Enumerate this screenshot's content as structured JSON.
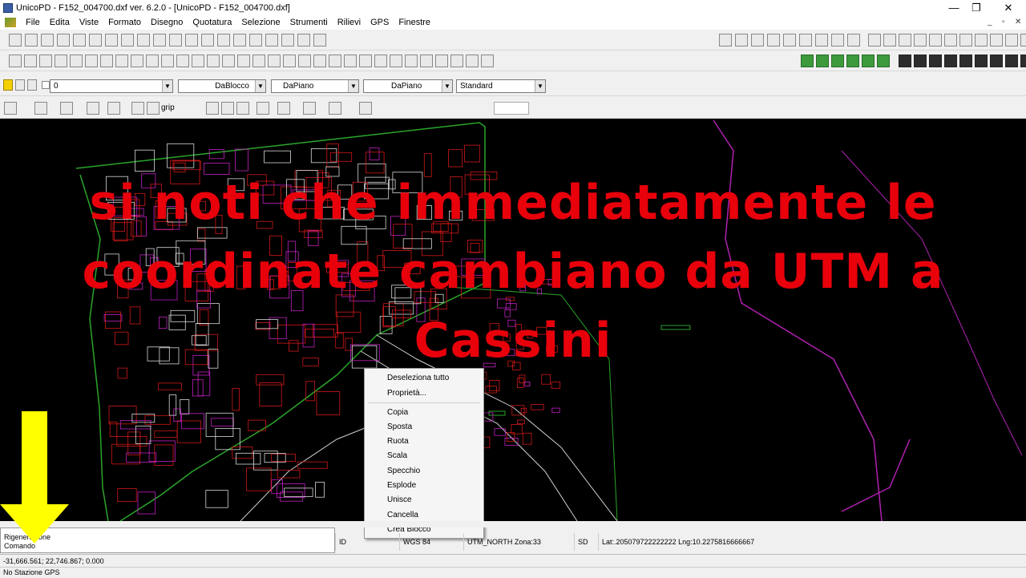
{
  "window": {
    "title": "UnicoPD - F152_004700.dxf ver. 6.2.0 - [UnicoPD - F152_004700.dxf]",
    "minimize": "—",
    "maximize": "❐",
    "close": "✕"
  },
  "menu": {
    "items": [
      "File",
      "Edita",
      "Viste",
      "Formato",
      "Disegno",
      "Quotatura",
      "Selezione",
      "Strumenti",
      "Rilievi",
      "GPS",
      "Finestre"
    ],
    "mdi_minimize": "_",
    "mdi_restore": "▫",
    "mdi_close": "✕"
  },
  "properties_bar": {
    "layer": "0",
    "linetype": "DaBlocco",
    "color": "DaPiano",
    "lineweight": "DaPiano",
    "style": "Standard"
  },
  "toolbar4": {
    "grip_label": "grip"
  },
  "overlay": {
    "text": "si noti che immediatamente le coordinate cambiano da UTM a Cassini"
  },
  "context_menu": {
    "group1": [
      "Deseleziona tutto",
      "Proprietà..."
    ],
    "group2": [
      "Copia",
      "Sposta",
      "Ruota",
      "Scala",
      "Specchio",
      "Esplode",
      "Unisce",
      "Cancella",
      "Crea Blocco"
    ]
  },
  "command": {
    "line1": "Rigenerazione",
    "line2": "Comando"
  },
  "status": {
    "id_label": "ID",
    "datum": "WGS 84",
    "projection": "UTM_NORTH  Zona:33",
    "sd_label": "SD",
    "latlng": "Lat:.205079722222222  Lng:10.2275816666667"
  },
  "coordinates": "-31,666.561; 22,746.867; 0.000",
  "gps_status": "No Stazione GPS",
  "colors": {
    "overlay_text": "#e8000b",
    "canvas_bg": "#000000",
    "arrow": "#ffff00"
  }
}
